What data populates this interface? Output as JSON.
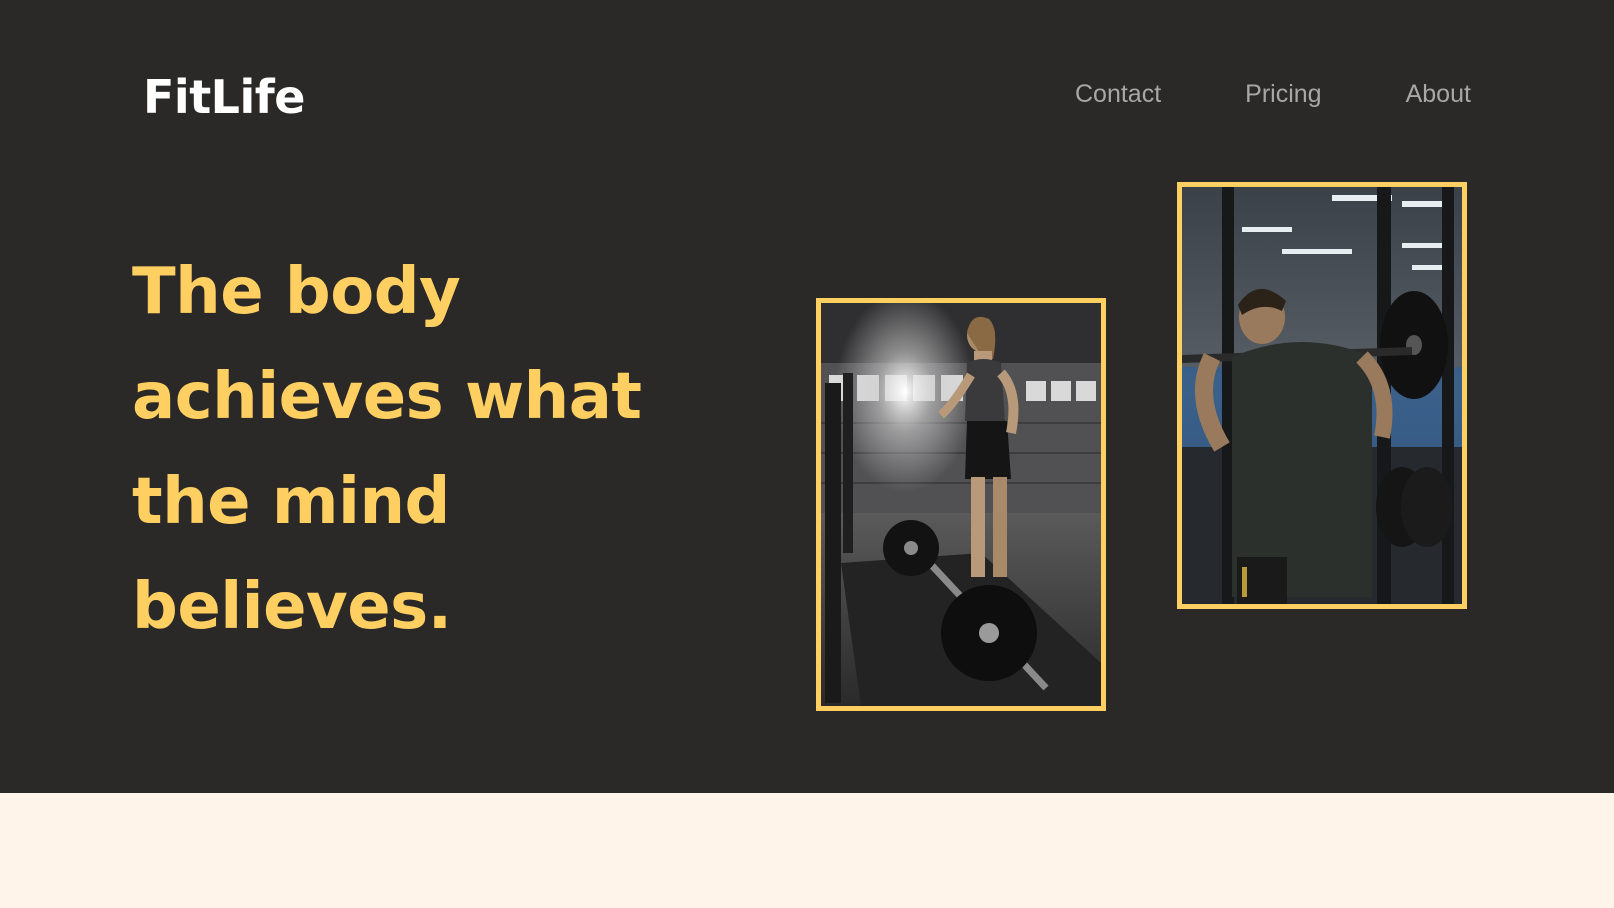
{
  "brand": {
    "name": "FitLife"
  },
  "nav": {
    "items": [
      {
        "label": "Contact"
      },
      {
        "label": "Pricing"
      },
      {
        "label": "About"
      }
    ]
  },
  "hero": {
    "headline_lines": [
      "The body",
      "achieves what",
      "the mind",
      "believes."
    ]
  },
  "photos": [
    {
      "icon": "woman-deadlift-photo"
    },
    {
      "icon": "man-squat-rack-photo"
    }
  ],
  "colors": {
    "hero_bg": "#2a2928",
    "accent": "#ffd061",
    "nav_text": "#a9a7a4",
    "page_bg": "#fff4ea"
  }
}
